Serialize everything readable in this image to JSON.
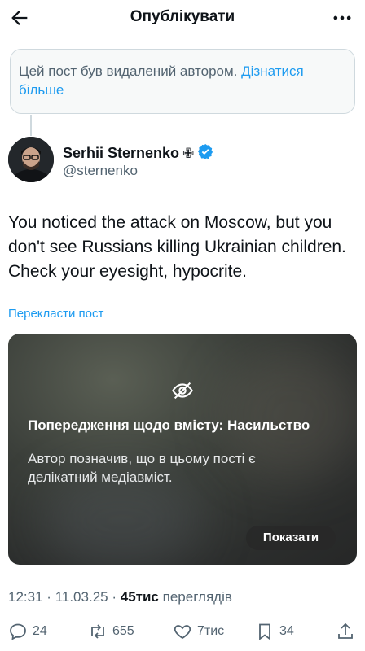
{
  "header": {
    "title": "Опублікувати"
  },
  "deleted_notice": {
    "text": "Цей пост був видалений автором.",
    "link": "Дізнатися більше"
  },
  "author": {
    "name": "Serhii Sternenko",
    "handle": "@sternenko",
    "badge_symbol": "✙",
    "verified_color": "#1d9bf0"
  },
  "tweet": {
    "text": "You noticed the attack on Moscow, but you don't see Russians killing Ukrainian children. Check your eyesight, hypocrite."
  },
  "translate_label": "Перекласти пост",
  "media_warning": {
    "title": "Попередження щодо вмісту: Насильство",
    "description": "Автор позначив, що в цьому пості є делікатний медіавміст.",
    "show_button": "Показати"
  },
  "meta": {
    "time": "12:31",
    "separator": "·",
    "date": "11.03.25",
    "views_count": "45тис",
    "views_label": "переглядів"
  },
  "actions": {
    "replies": "24",
    "reposts": "655",
    "likes": "7тис",
    "bookmarks": "34"
  },
  "colors": {
    "accent": "#1d9bf0",
    "text": "#0f1419",
    "secondary": "#536471"
  }
}
